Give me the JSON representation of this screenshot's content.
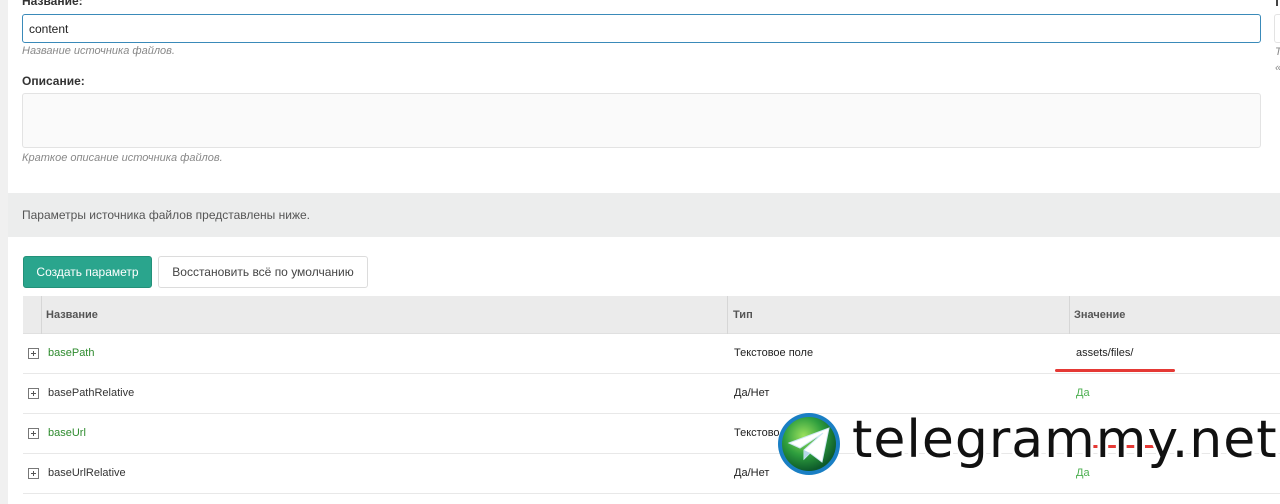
{
  "form": {
    "name_label": "Название:",
    "name_value": "content",
    "name_hint": "Название источника файлов.",
    "description_label": "Описание:",
    "description_value": "",
    "description_hint": "Краткое описание источника файлов.",
    "right_fragment_hint_1": "Т",
    "right_fragment_hint_2": "«"
  },
  "info_bar": {
    "text": "Параметры источника файлов представлены ниже."
  },
  "toolbar": {
    "create_label": "Создать параметр",
    "reset_label": "Восстановить всё по умолчанию"
  },
  "grid": {
    "columns": [
      "Название",
      "Тип",
      "Значение"
    ],
    "rows": [
      {
        "name": "basePath",
        "type": "Текстовое поле",
        "value": "assets/files/",
        "name_color": "green",
        "value_color": "dark"
      },
      {
        "name": "basePathRelative",
        "type": "Да/Нет",
        "value": "Да",
        "name_color": "dark",
        "value_color": "green"
      },
      {
        "name": "baseUrl",
        "type": "Текстово",
        "value": "",
        "name_color": "green",
        "value_color": "dark"
      },
      {
        "name": "baseUrlRelative",
        "type": "Да/Нет",
        "value": "Да",
        "name_color": "dark",
        "value_color": "green"
      }
    ]
  },
  "watermark": {
    "text": "telegrammy.net",
    "icon": "telegram-globe-icon"
  },
  "colors": {
    "primary_button": "#2aa58d",
    "link_green": "#2e8b2e",
    "value_green": "#4caf50",
    "focus_border": "#3a8ab9",
    "annotation_red": "#e53935"
  }
}
